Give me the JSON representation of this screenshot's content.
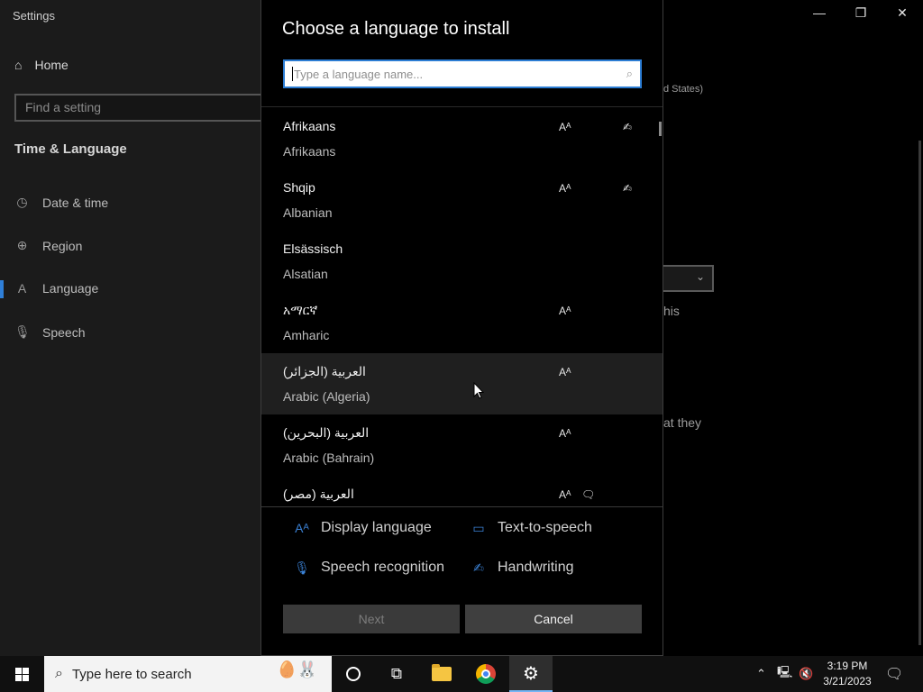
{
  "settings": {
    "app_title": "Settings",
    "home_label": "Home",
    "find_placeholder": "Find a setting",
    "section_title": "Time & Language",
    "nav": [
      {
        "label": "Date & time",
        "icon": "calendar-clock-icon"
      },
      {
        "label": "Region",
        "icon": "globe-icon"
      },
      {
        "label": "Language",
        "icon": "language-icon"
      },
      {
        "label": "Speech",
        "icon": "microphone-icon"
      }
    ],
    "bg_text": {
      "region_fragment": "d States)",
      "this_fragment": "his",
      "they_fragment": "at they"
    }
  },
  "dialog": {
    "title": "Choose a language to install",
    "search_placeholder": "Type a language name...",
    "languages": [
      {
        "native": "Afrikaans",
        "english": "Afrikaans",
        "features": [
          "display-language",
          "handwriting"
        ]
      },
      {
        "native": "Shqip",
        "english": "Albanian",
        "features": [
          "display-language",
          "handwriting"
        ]
      },
      {
        "native": "Elsässisch",
        "english": "Alsatian",
        "features": []
      },
      {
        "native": "አማርኛ",
        "english": "Amharic",
        "features": [
          "display-language"
        ]
      },
      {
        "native": "العربية (الجزائر)",
        "english": "Arabic (Algeria)",
        "features": [
          "display-language"
        ]
      },
      {
        "native": "العربية (البحرين)",
        "english": "Arabic (Bahrain)",
        "features": [
          "display-language"
        ]
      },
      {
        "native": "العربية (مصر)",
        "english": "",
        "features": [
          "display-language",
          "text-to-speech"
        ]
      }
    ],
    "legend": {
      "display_language": "Display language",
      "text_to_speech": "Text-to-speech",
      "speech_recognition": "Speech recognition",
      "handwriting": "Handwriting"
    },
    "next_label": "Next",
    "cancel_label": "Cancel"
  },
  "taskbar": {
    "search_placeholder": "Type here to search",
    "time": "3:19 PM",
    "date": "3/21/2023"
  },
  "colors": {
    "accent": "#2b7cd3",
    "legend_icon": "#3b82d6"
  }
}
